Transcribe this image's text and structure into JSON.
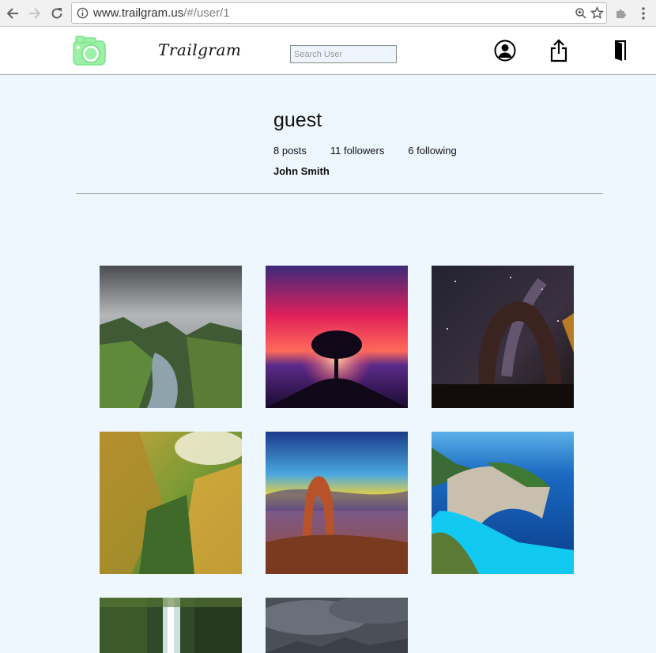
{
  "browser": {
    "url_host": "www.trailgram.us",
    "url_path": "/#/user/1"
  },
  "header": {
    "brand": "Trailgram",
    "search_placeholder": "Search User",
    "logo_color": "#9ef0a8"
  },
  "profile": {
    "username": "guest",
    "posts": "8 posts",
    "followers": "11 followers",
    "following": "6 following",
    "full_name": "John Smith"
  },
  "photos": [
    {
      "subject": "stormy fjord valley"
    },
    {
      "subject": "red sky tree sunset"
    },
    {
      "subject": "milky way rock arch"
    },
    {
      "subject": "golden green canyon"
    },
    {
      "subject": "desert arch at sunset"
    },
    {
      "subject": "blue lagoon beach cliffs"
    },
    {
      "subject": "forest waterfall"
    },
    {
      "subject": "cloudy mountain range"
    }
  ]
}
